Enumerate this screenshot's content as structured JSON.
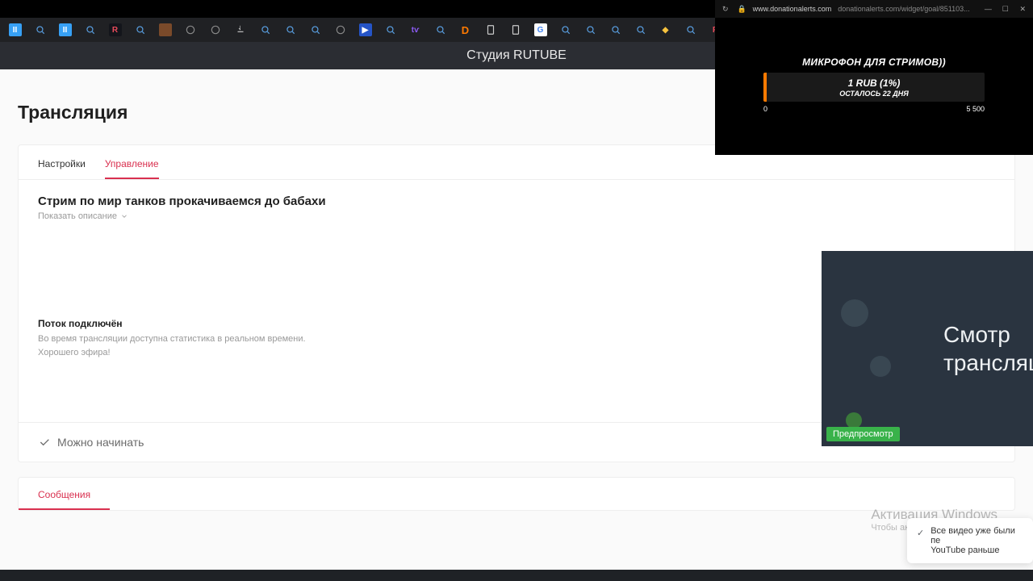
{
  "header": {
    "title": "Студия RUTUBE"
  },
  "page": {
    "title": "Трансляция"
  },
  "tabs": {
    "settings": "Настройки",
    "manage": "Управление"
  },
  "stream": {
    "title": "Стрим по мир танков прокачиваемся до бабахи",
    "show_desc": "Показать описание",
    "status_title": "Поток подключён",
    "status_line1": "Во время трансляции доступна статистика в реальном времени.",
    "status_line2": "Хорошего эфира!"
  },
  "ready": {
    "label": "Можно начинать"
  },
  "messages": {
    "tab": "Сообщения"
  },
  "preview": {
    "line1": "Смотр",
    "line2": "трансляц",
    "badge": "Предпросмотр"
  },
  "donation": {
    "host": "www.donationalerts.com",
    "path": "donationalerts.com/widget/goal/851103...",
    "goal_title": "МИКРОФОН ДЛЯ СТРИМОВ))",
    "amount": "1 RUB (1%)",
    "days_left": "ОСТАЛОСЬ 22 ДНЯ",
    "min": "0",
    "max": "5 500"
  },
  "watermark": {
    "title": "Активация Windows",
    "sub": "Чтобы активировать ..."
  },
  "popup": {
    "line1": "Все видео уже были пе",
    "line2": "YouTube раньше"
  }
}
